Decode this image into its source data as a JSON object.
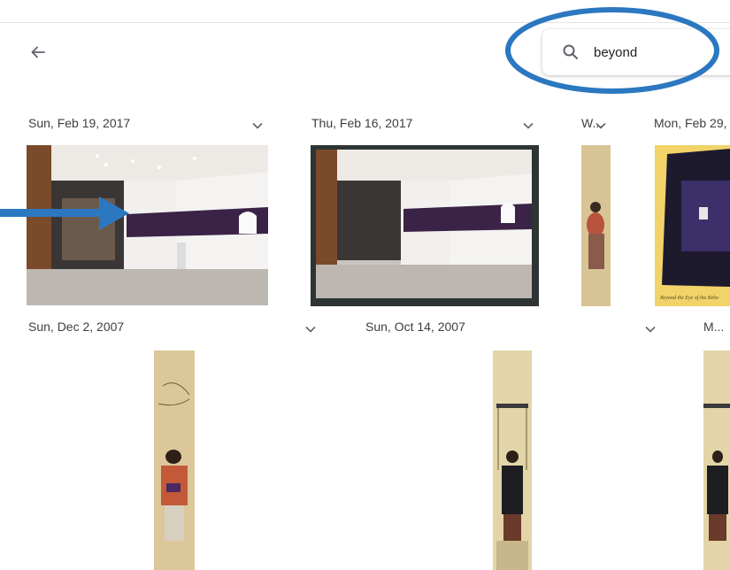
{
  "search": {
    "query": "beyond",
    "icon": "search-icon"
  },
  "nav": {
    "back_icon": "arrow-left-icon"
  },
  "groups_row1": [
    {
      "date": "Sun, Feb 19, 2017"
    },
    {
      "date": "Thu, Feb 16, 2017"
    },
    {
      "date": "W..."
    },
    {
      "date": "Mon, Feb 29,"
    }
  ],
  "groups_row2": [
    {
      "date": "Sun, Dec 2, 2007"
    },
    {
      "date": "Sun, Oct 14, 2007"
    },
    {
      "date": "M..."
    }
  ],
  "annotations": {
    "oval_color": "#2b78c0",
    "arrow_color": "#2b78c0"
  },
  "poster_caption": "Beyond the Eye of the Beho"
}
